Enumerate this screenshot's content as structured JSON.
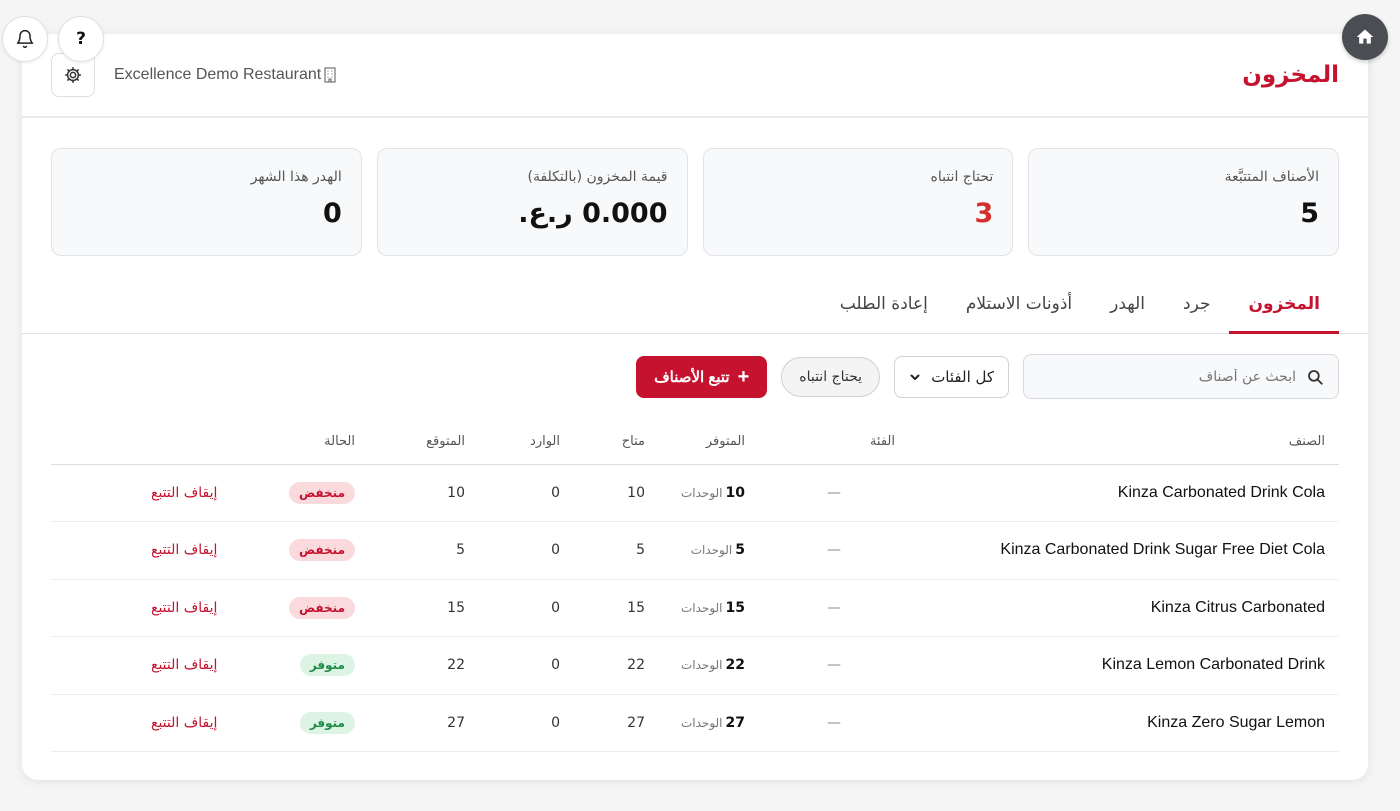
{
  "top_bar": {
    "help_label": "?"
  },
  "header": {
    "restaurant_name": "Excellence Demo Restaurant",
    "title": "المخزون"
  },
  "stats": [
    {
      "label": "الأصناف المتتبَّعة",
      "value": "5"
    },
    {
      "label": "تحتاج انتباه",
      "value": "3",
      "color": "#d32f2f"
    },
    {
      "label": "قيمة المخزون (بالتكلفة)",
      "value": "0.000 ر.ع."
    },
    {
      "label": "الهدر هذا الشهر",
      "value": "0"
    }
  ],
  "tabs": [
    {
      "label": "المخزون",
      "active": true
    },
    {
      "label": "جرد"
    },
    {
      "label": "الهدر"
    },
    {
      "label": "أذونات الاستلام"
    },
    {
      "label": "إعادة الطلب"
    }
  ],
  "toolbar": {
    "search_placeholder": "ابحث عن أصناف",
    "category_select": "كل الفئات",
    "attention_chip": "يحتاج انتباه",
    "track_button": "تتبع الأصناف"
  },
  "table": {
    "columns": {
      "item": "الصنف",
      "category": "الفئة",
      "on_hand": "المتوفر",
      "available": "متاح",
      "incoming": "الوارد",
      "expected": "المتوقع",
      "status": "الحالة"
    },
    "unit_label": "الوحدات",
    "rows": [
      {
        "item": "Kinza Carbonated Drink Cola",
        "category": "—",
        "on_hand": "10",
        "available": "10",
        "incoming": "0",
        "expected": "10",
        "status": "منخفض",
        "action": "إيقاف التتبع"
      },
      {
        "item": "Kinza Carbonated Drink Sugar Free Diet Cola",
        "category": "—",
        "on_hand": "5",
        "available": "5",
        "incoming": "0",
        "expected": "5",
        "status": "منخفض",
        "action": "إيقاف التتبع"
      },
      {
        "item": "Kinza Citrus Carbonated",
        "category": "—",
        "on_hand": "15",
        "available": "15",
        "incoming": "0",
        "expected": "15",
        "status": "منخفض",
        "action": "إيقاف التتبع"
      },
      {
        "item": "Kinza Lemon Carbonated Drink",
        "category": "—",
        "on_hand": "22",
        "available": "22",
        "incoming": "0",
        "expected": "22",
        "status": "متوفر",
        "action": "إيقاف التتبع"
      },
      {
        "item": "Kinza Zero Sugar Lemon",
        "category": "—",
        "on_hand": "27",
        "available": "27",
        "incoming": "0",
        "expected": "27",
        "status": "متوفر",
        "action": "إيقاف التتبع"
      }
    ]
  },
  "colors": {
    "accent": "#c4122f",
    "low_badge_bg": "#fadadd",
    "ok_badge_bg": "#ddf3e4",
    "ok_text": "#1d8a45"
  }
}
